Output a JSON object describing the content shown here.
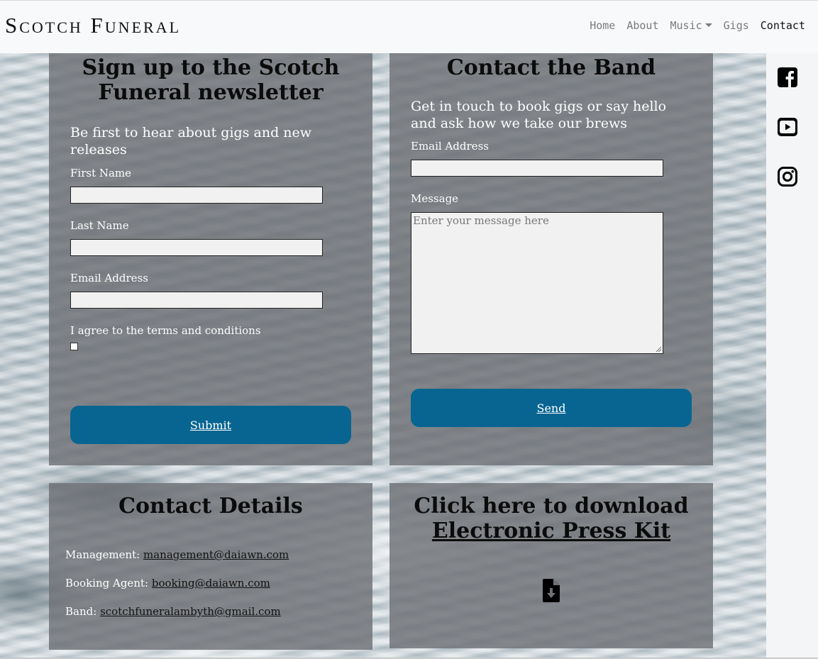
{
  "brand": "Scotch Funeral",
  "nav": {
    "home": "Home",
    "about": "About",
    "music": "Music",
    "gigs": "Gigs",
    "contact": "Contact"
  },
  "newsletter": {
    "title_line1": "Sign up to the Scotch",
    "title_line2": "Funeral newsletter",
    "lead_line1": "Be first to hear about gigs and new",
    "lead_line2": "releases",
    "first_name_label": "First Name",
    "last_name_label": "Last Name",
    "email_label": "Email Address",
    "terms_label": "I agree to the terms and conditions",
    "submit_label": "Submit"
  },
  "contact_band": {
    "title": "Contact the Band",
    "lead_line1": "Get in touch to book gigs or say hello",
    "lead_line2": "and ask how we take our brews",
    "email_label": "Email Address",
    "message_label": "Message",
    "message_placeholder": "Enter your message here",
    "send_label": "Send"
  },
  "contact_details": {
    "title": "Contact Details",
    "management_label": "Management:",
    "management_email": "management@daiawn.com",
    "booking_label": "Booking Agent:",
    "booking_email": "booking@daiawn.com",
    "band_label": "Band:",
    "band_email": "scotchfuneralambyth@gmail.com"
  },
  "press_kit": {
    "title_line1": "Click here to download",
    "title_line2": "Electronic Press Kit"
  },
  "social_icons": [
    "facebook-icon",
    "youtube-icon",
    "instagram-icon"
  ],
  "colors": {
    "button": "#086591",
    "panel": "#6e7075",
    "navbar": "#f8f9fa"
  }
}
